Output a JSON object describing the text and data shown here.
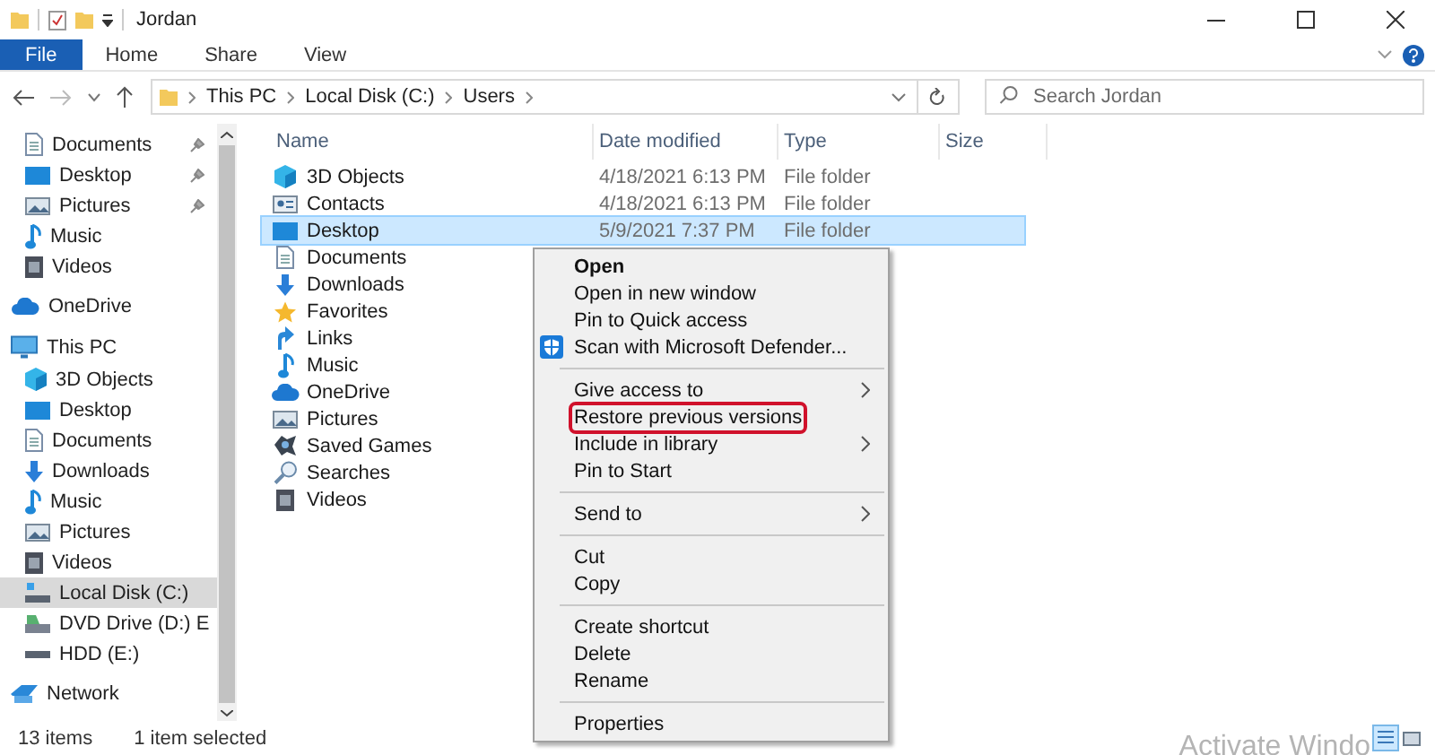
{
  "window": {
    "title": "Jordan"
  },
  "ribbon_tabs": [
    {
      "label": "File",
      "selected": true
    },
    {
      "label": "Home",
      "selected": false
    },
    {
      "label": "Share",
      "selected": false
    },
    {
      "label": "View",
      "selected": false
    }
  ],
  "address_bar": {
    "path": [
      "This PC",
      "Local Disk (C:)",
      "Users"
    ]
  },
  "search": {
    "placeholder": "Search Jordan"
  },
  "sidebar": {
    "quick_access": [
      {
        "label": "Documents",
        "kind": "document",
        "pinned": true
      },
      {
        "label": "Desktop",
        "kind": "desktop",
        "pinned": true
      },
      {
        "label": "Pictures",
        "kind": "picture",
        "pinned": true
      },
      {
        "label": "Music",
        "kind": "music",
        "pinned": false
      },
      {
        "label": "Videos",
        "kind": "video",
        "pinned": false
      }
    ],
    "tree": [
      {
        "label": "OneDrive",
        "kind": "cloud",
        "selected": false
      },
      {
        "label": "This PC",
        "kind": "monitor",
        "selected": false,
        "children": [
          {
            "label": "3D Objects",
            "kind": "cube",
            "selected": false
          },
          {
            "label": "Desktop",
            "kind": "desktop",
            "selected": false
          },
          {
            "label": "Documents",
            "kind": "document",
            "selected": false
          },
          {
            "label": "Downloads",
            "kind": "download",
            "selected": false
          },
          {
            "label": "Music",
            "kind": "music",
            "selected": false
          },
          {
            "label": "Pictures",
            "kind": "picture",
            "selected": false
          },
          {
            "label": "Videos",
            "kind": "video",
            "selected": false
          },
          {
            "label": "Local Disk (C:)",
            "kind": "disk",
            "selected": true
          },
          {
            "label": "DVD Drive (D:) E",
            "kind": "dvd",
            "selected": false
          },
          {
            "label": "HDD (E:)",
            "kind": "hdd",
            "selected": false
          }
        ]
      },
      {
        "label": "Network",
        "kind": "network",
        "selected": false
      }
    ]
  },
  "file_list": {
    "columns": [
      "Name",
      "Date modified",
      "Type",
      "Size"
    ],
    "rows": [
      {
        "name": "3D Objects",
        "kind": "cube",
        "date": "4/18/2021 6:13 PM",
        "type": "File folder",
        "selected": false
      },
      {
        "name": "Contacts",
        "kind": "contact",
        "date": "4/18/2021 6:13 PM",
        "type": "File folder",
        "selected": false
      },
      {
        "name": "Desktop",
        "kind": "desktop",
        "date": "5/9/2021 7:37 PM",
        "type": "File folder",
        "selected": true
      },
      {
        "name": "Documents",
        "kind": "document",
        "selected": false
      },
      {
        "name": "Downloads",
        "kind": "download",
        "selected": false
      },
      {
        "name": "Favorites",
        "kind": "star",
        "selected": false
      },
      {
        "name": "Links",
        "kind": "link",
        "selected": false
      },
      {
        "name": "Music",
        "kind": "music",
        "selected": false
      },
      {
        "name": "OneDrive",
        "kind": "cloud",
        "selected": false
      },
      {
        "name": "Pictures",
        "kind": "picture",
        "selected": false
      },
      {
        "name": "Saved Games",
        "kind": "game",
        "selected": false
      },
      {
        "name": "Searches",
        "kind": "search",
        "selected": false
      },
      {
        "name": "Videos",
        "kind": "video",
        "selected": false
      }
    ]
  },
  "context_menu": {
    "items": [
      {
        "kind": "item",
        "label": "Open",
        "bold": true,
        "submenu": false,
        "highlighted": false
      },
      {
        "kind": "item",
        "label": "Open in new window",
        "bold": false,
        "submenu": false,
        "highlighted": false
      },
      {
        "kind": "item",
        "label": "Pin to Quick access",
        "bold": false,
        "submenu": false,
        "highlighted": false
      },
      {
        "kind": "shield",
        "label": "Scan with Microsoft Defender...",
        "bold": false,
        "submenu": false,
        "highlighted": false
      },
      {
        "kind": "separator"
      },
      {
        "kind": "item",
        "label": "Give access to",
        "bold": false,
        "submenu": true,
        "highlighted": false
      },
      {
        "kind": "item",
        "label": "Restore previous versions",
        "bold": false,
        "submenu": false,
        "highlighted": true
      },
      {
        "kind": "item",
        "label": "Include in library",
        "bold": false,
        "submenu": true,
        "highlighted": false
      },
      {
        "kind": "item",
        "label": "Pin to Start",
        "bold": false,
        "submenu": false,
        "highlighted": false
      },
      {
        "kind": "separator"
      },
      {
        "kind": "item",
        "label": "Send to",
        "bold": false,
        "submenu": true,
        "highlighted": false
      },
      {
        "kind": "separator"
      },
      {
        "kind": "item",
        "label": "Cut",
        "bold": false,
        "submenu": false,
        "highlighted": false
      },
      {
        "kind": "item",
        "label": "Copy",
        "bold": false,
        "submenu": false,
        "highlighted": false
      },
      {
        "kind": "separator"
      },
      {
        "kind": "item",
        "label": "Create shortcut",
        "bold": false,
        "submenu": false,
        "highlighted": false
      },
      {
        "kind": "item",
        "label": "Delete",
        "bold": false,
        "submenu": false,
        "highlighted": false
      },
      {
        "kind": "item",
        "label": "Rename",
        "bold": false,
        "submenu": false,
        "highlighted": false
      },
      {
        "kind": "separator"
      },
      {
        "kind": "item",
        "label": "Properties",
        "bold": false,
        "submenu": false,
        "highlighted": false
      }
    ]
  },
  "status_bar": {
    "item_count": "13 items",
    "selection": "1 item selected"
  },
  "activation_notice": "Activate Windo"
}
